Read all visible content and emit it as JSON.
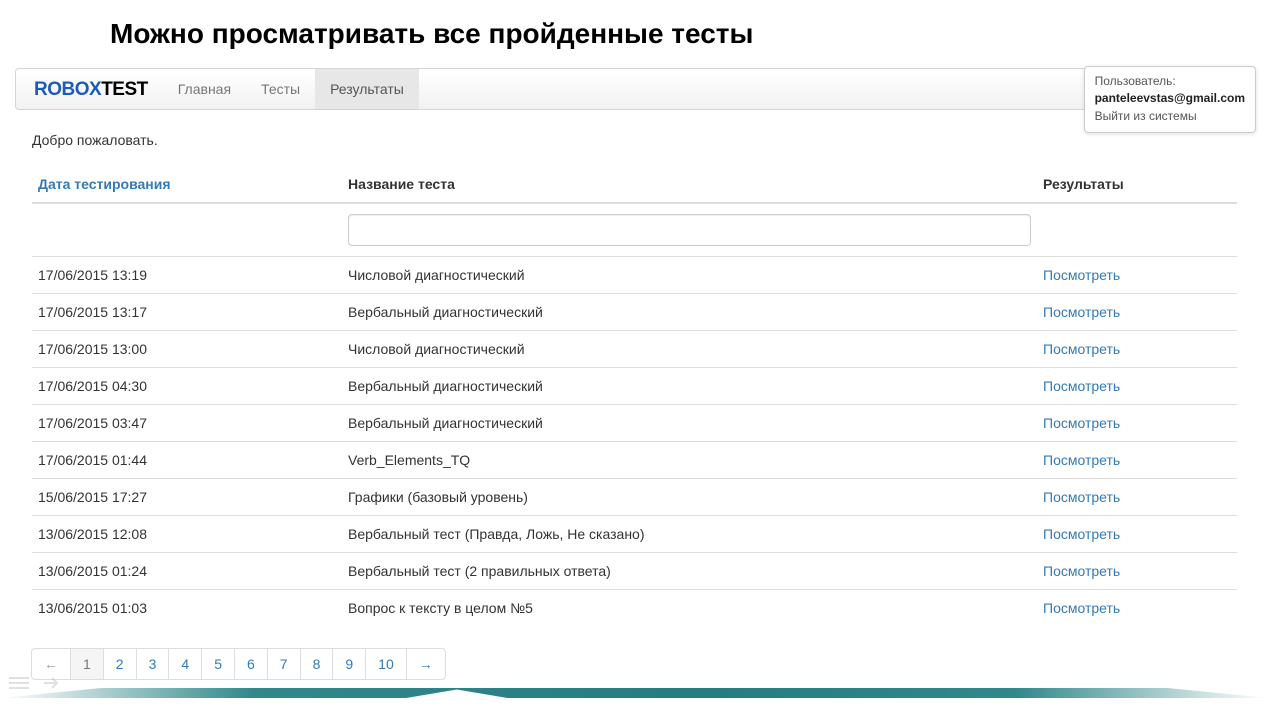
{
  "page": {
    "title": "Можно просматривать все пройденные тесты",
    "welcome": "Добро пожаловать."
  },
  "brand": {
    "part1": "ROBOX",
    "part2": "TEST"
  },
  "nav": {
    "items": [
      {
        "label": "Главная",
        "active": false
      },
      {
        "label": "Тесты",
        "active": false
      },
      {
        "label": "Результаты",
        "active": true
      }
    ]
  },
  "user": {
    "label": "Пользователь:",
    "email": "panteleevstas@gmail.com",
    "logout": "Выйти из системы"
  },
  "table": {
    "headers": {
      "date": "Дата тестирования",
      "name": "Название теста",
      "results": "Результаты"
    },
    "filter_value": "",
    "view_label": "Посмотреть",
    "rows": [
      {
        "date": "17/06/2015 13:19",
        "name": "Числовой диагностический"
      },
      {
        "date": "17/06/2015 13:17",
        "name": "Вербальный диагностический"
      },
      {
        "date": "17/06/2015 13:00",
        "name": "Числовой диагностический"
      },
      {
        "date": "17/06/2015 04:30",
        "name": "Вербальный диагностический"
      },
      {
        "date": "17/06/2015 03:47",
        "name": "Вербальный диагностический"
      },
      {
        "date": "17/06/2015 01:44",
        "name": "Verb_Elements_TQ"
      },
      {
        "date": "15/06/2015 17:27",
        "name": "Графики (базовый уровень)"
      },
      {
        "date": "13/06/2015 12:08",
        "name": "Вербальный тест (Правда, Ложь, Не сказано)"
      },
      {
        "date": "13/06/2015 01:24",
        "name": "Вербальный тест (2 правильных ответа)"
      },
      {
        "date": "13/06/2015 01:03",
        "name": "Вопрос к тексту в целом №5"
      }
    ]
  },
  "pagination": {
    "prev": "←",
    "next": "→",
    "pages": [
      "1",
      "2",
      "3",
      "4",
      "5",
      "6",
      "7",
      "8",
      "9",
      "10"
    ],
    "active": "1"
  }
}
